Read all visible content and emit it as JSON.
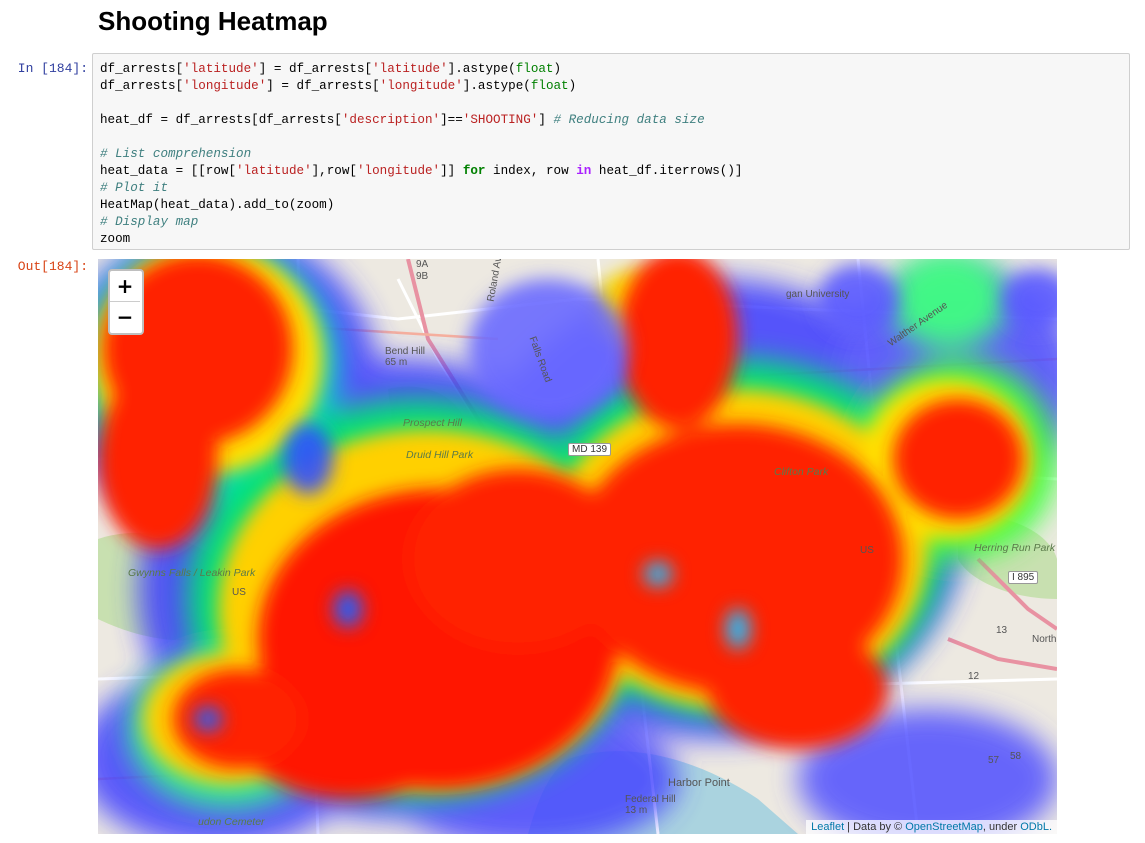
{
  "heading": "Shooting Heatmap",
  "cell": {
    "in_prompt": "In [184]:",
    "out_prompt": "Out[184]:"
  },
  "code_lines": [
    "df_arrests['latitude'] = df_arrests['latitude'].astype(float)",
    "df_arrests['longitude'] = df_arrests['longitude'].astype(float)",
    "",
    "heat_df = df_arrests[df_arrests['description']=='SHOOTING'] # Reducing data size",
    "",
    "# List comprehension",
    "heat_data = [[row['latitude'],row['longitude']] for index, row in heat_df.iterrows()]",
    "# Plot it",
    "HeatMap(heat_data).add_to(zoom)",
    "# Display map",
    "zoom"
  ],
  "map": {
    "zoom_in": "+",
    "zoom_out": "−",
    "attribution": {
      "leaflet": "Leaflet",
      "sep1": " | Data by © ",
      "osm": "OpenStreetMap",
      "sep2": ", under ",
      "odbl": "ODbL."
    },
    "labels": {
      "bend_hill": "Bend Hill",
      "bend_hill_elev": "65 m",
      "prospect_hill": "Prospect Hill",
      "druid_hill_park": "Druid Hill Park",
      "md139": "MD 139",
      "clifton_park": "Clifton Park",
      "gwynns_falls": "Gwynns Falls / Leakin Park",
      "us_left": "US",
      "us_right": "US",
      "herring_run": "Herring Run Park",
      "i895": "I 895",
      "harbor_point": "Harbor Point",
      "federal_hill": "Federal Hill",
      "federal_hill_elev": "13 m",
      "falls_road": "Falls Road",
      "roland_ave": "Roland Ave",
      "walther_ave": "Walther Avenue",
      "university": "gan University",
      "north": "North",
      "exit_9a": "9A",
      "exit_9b": "9B",
      "exit_13": "13",
      "exit_12": "12",
      "exit_57": "57",
      "exit_58": "58",
      "audon_cemetery": "udon Cemeter"
    },
    "heat_colors": [
      "#0000ff",
      "#00ffff",
      "#00ff00",
      "#ffff00",
      "#ff0000"
    ]
  }
}
